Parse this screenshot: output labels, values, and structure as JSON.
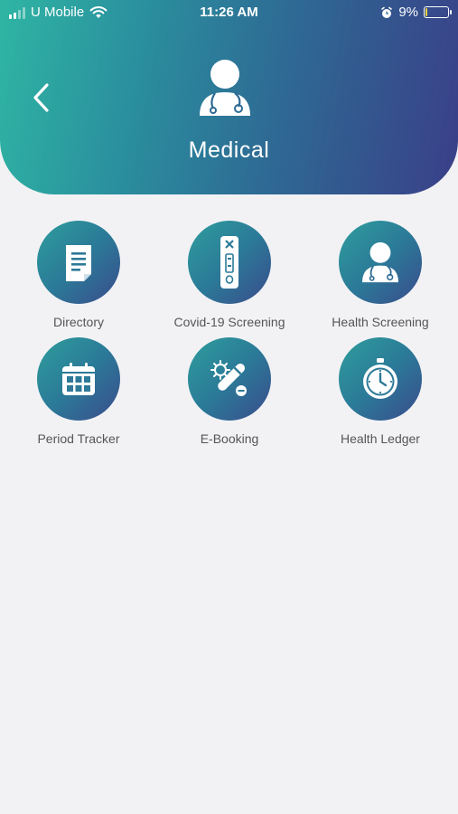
{
  "status_bar": {
    "carrier": "U Mobile",
    "time": "11:26 AM",
    "battery_percent": "9%",
    "battery_level": 0.09
  },
  "header": {
    "title": "Medical",
    "back_icon": "chevron-left-icon",
    "icon": "doctor-icon"
  },
  "colors": {
    "gradient_start": "#2fb5a3",
    "gradient_end": "#3a3f88",
    "background": "#f2f2f5",
    "label": "#555555"
  },
  "menu": [
    {
      "label": "Directory",
      "icon": "document-icon"
    },
    {
      "label": "Covid-19 Screening",
      "icon": "test-kit-icon"
    },
    {
      "label": "Health Screening",
      "icon": "doctor-icon"
    },
    {
      "label": "Period Tracker",
      "icon": "calendar-icon"
    },
    {
      "label": "E-Booking",
      "icon": "vaccine-icon"
    },
    {
      "label": "Health Ledger",
      "icon": "stopwatch-icon"
    }
  ]
}
